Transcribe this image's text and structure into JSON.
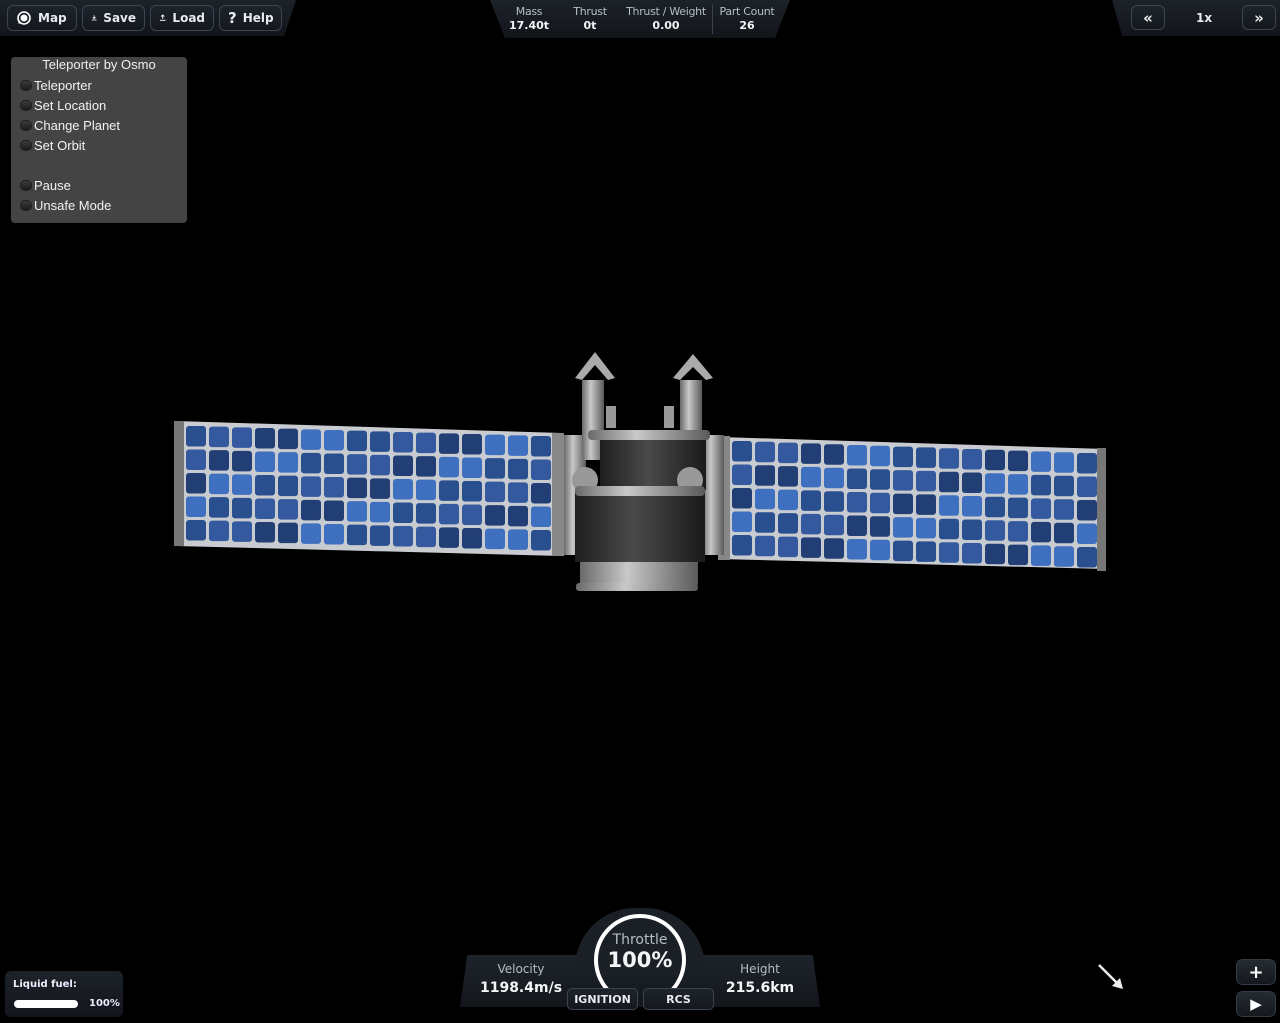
{
  "toolbar": {
    "buttons": [
      {
        "label": "Map",
        "icon": "map-icon"
      },
      {
        "label": "Save",
        "icon": "save-icon"
      },
      {
        "label": "Load",
        "icon": "load-icon"
      },
      {
        "label": "Help",
        "icon": "help-icon"
      }
    ]
  },
  "stats": {
    "mass": {
      "label": "Mass",
      "value": "17.40t"
    },
    "thrust": {
      "label": "Thrust",
      "value": "0t"
    },
    "twr": {
      "label": "Thrust / Weight",
      "value": "0.00"
    },
    "parts": {
      "label": "Part Count",
      "value": "26"
    }
  },
  "time_warp": {
    "slower_label": "«",
    "faster_label": "»",
    "value": "1x"
  },
  "teleporter": {
    "title": "Teleporter by Osmo",
    "items": [
      {
        "label": "Teleporter",
        "on": false
      },
      {
        "label": "Set Location",
        "on": false
      },
      {
        "label": "Change Planet",
        "on": false
      },
      {
        "label": "Set Orbit",
        "on": false
      },
      {
        "label": "Pause",
        "on": false
      },
      {
        "label": "Unsafe Mode",
        "on": false
      }
    ]
  },
  "fuel": {
    "label": "Liquid fuel:",
    "percent_text": "100%",
    "fraction": 1.0
  },
  "flight": {
    "velocity": {
      "label": "Velocity",
      "value": "1198.4m/s"
    },
    "throttle": {
      "label": "Throttle",
      "value": "100%",
      "fraction": 1.0
    },
    "height": {
      "label": "Height",
      "value": "215.6km"
    },
    "ignition_label": "IGNITION",
    "rcs_label": "RCS"
  },
  "controls": {
    "add_label": "+",
    "play_label": "▶"
  },
  "colors": {
    "panel_bg": "#444444",
    "hud_bg": "#1a1f25",
    "solar_cell": "#2a4f8f",
    "solar_cell_light": "#3f6fbf",
    "solar_frame": "#c8ccd0"
  }
}
